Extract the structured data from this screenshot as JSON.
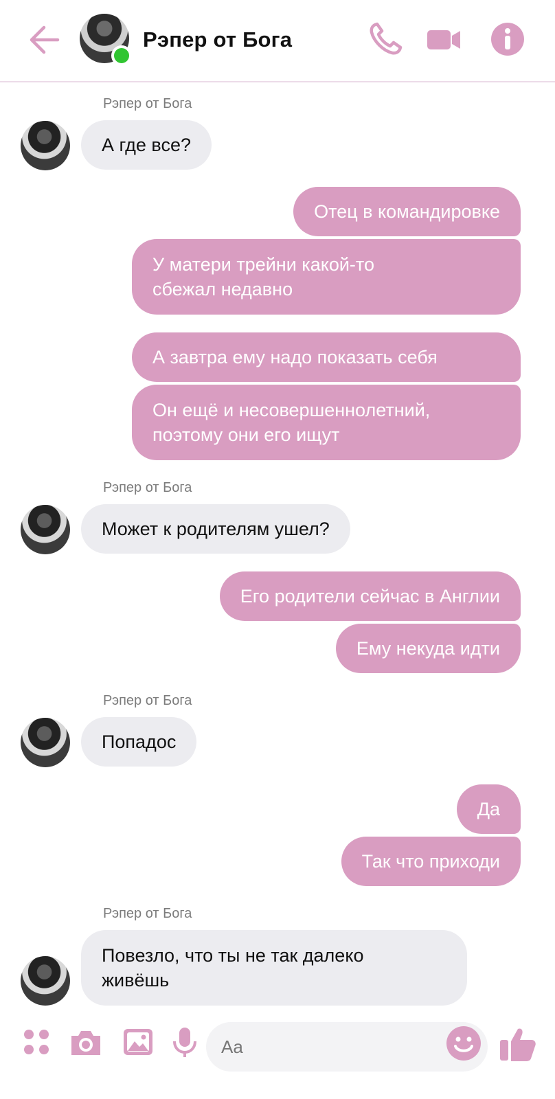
{
  "header": {
    "contact_name": "Рэпер от Бога",
    "online": true
  },
  "colors": {
    "accent": "#d99dc1",
    "outgoing_bubble": "#d99dc1",
    "incoming_bubble": "#ececf0",
    "online": "#31c532"
  },
  "icons": {
    "back": "arrow-left-icon",
    "call": "phone-icon",
    "video": "video-camera-icon",
    "info": "info-icon",
    "menu": "four-dots-icon",
    "camera": "camera-icon",
    "gallery": "image-icon",
    "mic": "microphone-icon",
    "emoji": "smiley-icon",
    "like": "thumbs-up-icon"
  },
  "messages": {
    "sender_1": "Рэпер от Бога",
    "m1": "А где все?",
    "o1": "Отец в командировке",
    "o2_l1": "У матери трейни какой-то",
    "o2_l2": "сбежал недавно",
    "o3": "А завтра ему надо показать себя",
    "o4_l1": "Он ещё и несовершеннолетний,",
    "o4_l2": "поэтому они его ищут",
    "sender_2": "Рэпер от Бога",
    "m2": "Может к родителям ушел?",
    "o5": "Его родители сейчас в Англии",
    "o6": "Ему некуда идти",
    "sender_3": "Рэпер от Бога",
    "m3": "Попадос",
    "o7": "Да",
    "o8": "Так что приходи",
    "sender_4": "Рэпер от Бога",
    "m4_l1": "Повезло, что ты не так далеко",
    "m4_l2": "живёшь"
  },
  "composer": {
    "placeholder": "Aa"
  }
}
